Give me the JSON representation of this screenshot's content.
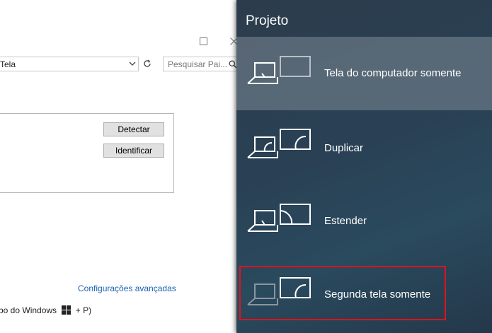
{
  "control_panel": {
    "address_text": "Tela",
    "search_placeholder": "Pesquisar Pai...",
    "buttons": {
      "detect": "Detectar",
      "identify": "Identificar"
    },
    "advanced_link": "Configurações avançadas",
    "footer_prefix": "po do Windows",
    "footer_suffix": "+ P)"
  },
  "project_flyout": {
    "title": "Projeto",
    "options": [
      {
        "label": "Tela do computador somente",
        "icon": "pc-screen-only-icon",
        "selected": true
      },
      {
        "label": "Duplicar",
        "icon": "duplicate-icon",
        "selected": false
      },
      {
        "label": "Estender",
        "icon": "extend-icon",
        "selected": false
      },
      {
        "label": "Segunda tela somente",
        "icon": "second-screen-only-icon",
        "selected": false,
        "highlighted": true
      }
    ]
  },
  "colors": {
    "highlight_border": "#e0121c",
    "link": "#1a5fb4",
    "flyout_bg": "#2a4155"
  }
}
